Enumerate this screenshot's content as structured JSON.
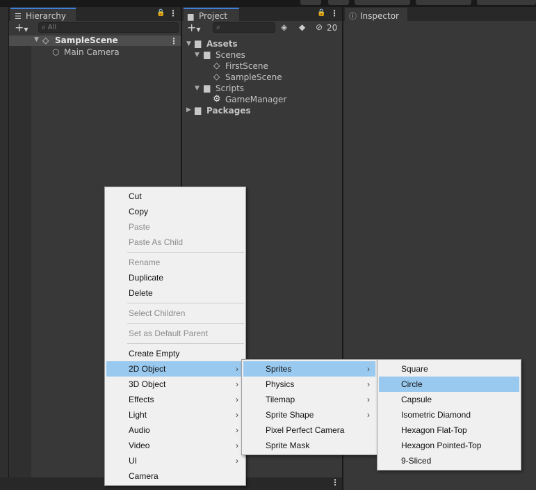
{
  "hierarchy": {
    "tab_label": "Hierarchy",
    "search_placeholder": "All",
    "add_label": "+",
    "scene": "SampleScene",
    "items": [
      "Main Camera"
    ]
  },
  "project": {
    "tab_label": "Project",
    "add_label": "+",
    "hidden_count": "20",
    "tree": {
      "assets": "Assets",
      "scenes_folder": "Scenes",
      "scenes": [
        "FirstScene",
        "SampleScene"
      ],
      "scripts_folder": "Scripts",
      "scripts": [
        "GameManager"
      ],
      "packages": "Packages"
    }
  },
  "inspector": {
    "tab_label": "Inspector"
  },
  "context_menu": {
    "items": [
      {
        "label": "Cut",
        "enabled": true
      },
      {
        "label": "Copy",
        "enabled": true
      },
      {
        "label": "Paste",
        "enabled": false
      },
      {
        "label": "Paste As Child",
        "enabled": false
      },
      {
        "label": "Rename",
        "enabled": false
      },
      {
        "label": "Duplicate",
        "enabled": true
      },
      {
        "label": "Delete",
        "enabled": true
      },
      {
        "label": "Select Children",
        "enabled": false
      },
      {
        "label": "Set as Default Parent",
        "enabled": false
      },
      {
        "label": "Create Empty",
        "enabled": true
      },
      {
        "label": "2D Object",
        "enabled": true,
        "submenu": true,
        "highlighted": true
      },
      {
        "label": "3D Object",
        "enabled": true,
        "submenu": true
      },
      {
        "label": "Effects",
        "enabled": true,
        "submenu": true
      },
      {
        "label": "Light",
        "enabled": true,
        "submenu": true
      },
      {
        "label": "Audio",
        "enabled": true,
        "submenu": true
      },
      {
        "label": "Video",
        "enabled": true,
        "submenu": true
      },
      {
        "label": "UI",
        "enabled": true,
        "submenu": true
      },
      {
        "label": "Camera",
        "enabled": true
      }
    ],
    "submenu_arrow": "›"
  },
  "submenu_2d": {
    "items": [
      {
        "label": "Sprites",
        "submenu": true,
        "highlighted": true
      },
      {
        "label": "Physics",
        "submenu": true
      },
      {
        "label": "Tilemap",
        "submenu": true
      },
      {
        "label": "Sprite Shape",
        "submenu": true
      },
      {
        "label": "Pixel Perfect Camera"
      },
      {
        "label": "Sprite Mask"
      }
    ]
  },
  "submenu_sprites": {
    "items": [
      {
        "label": "Square"
      },
      {
        "label": "Circle",
        "highlighted": true
      },
      {
        "label": "Capsule"
      },
      {
        "label": "Isometric Diamond"
      },
      {
        "label": "Hexagon Flat-Top"
      },
      {
        "label": "Hexagon Pointed-Top"
      },
      {
        "label": "9-Sliced"
      }
    ]
  },
  "colors": {
    "menu_highlight": "#99c9ef",
    "tab_accent": "#3d7fd9",
    "panel_bg": "#383838",
    "editor_bg": "#191919"
  }
}
